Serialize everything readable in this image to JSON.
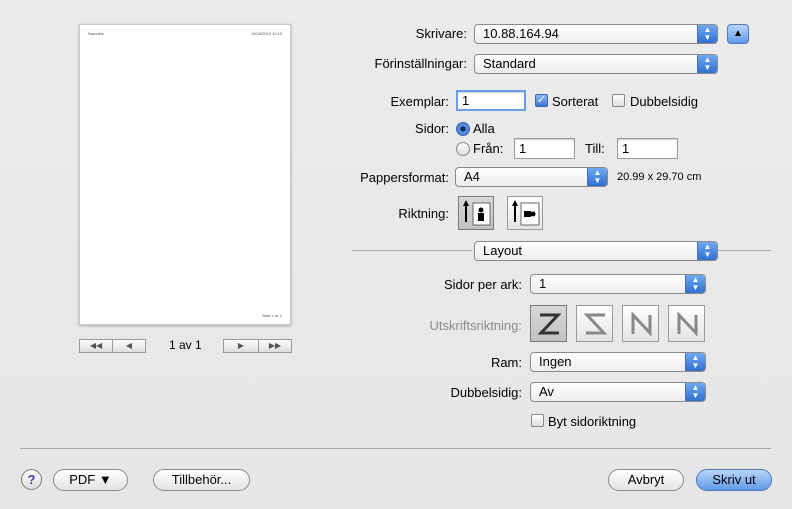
{
  "printer": {
    "label": "Skrivare:",
    "value": "10.88.164.94"
  },
  "presets": {
    "label": "Förinställningar:",
    "value": "Standard"
  },
  "copies": {
    "label": "Exemplar:",
    "value": "1",
    "collated_label": "Sorterat",
    "collated": true,
    "duplex_label": "Dubbelsidig",
    "duplex": false
  },
  "pages": {
    "label": "Sidor:",
    "all_label": "Alla",
    "from_label": "Från:",
    "from_value": "1",
    "to_label": "Till:",
    "to_value": "1"
  },
  "paper": {
    "label": "Pappersformat:",
    "value": "A4",
    "size_text": "20.99 x 29.70 cm"
  },
  "orientation": {
    "label": "Riktning:"
  },
  "section": {
    "value": "Layout"
  },
  "layout": {
    "pages_per_sheet_label": "Sidor per ark:",
    "pages_per_sheet": "1",
    "direction_label": "Utskriftsriktning:",
    "border_label": "Ram:",
    "border": "Ingen",
    "two_sided_label": "Dubbelsidig:",
    "two_sided": "Av",
    "flip_label": "Byt sidoriktning",
    "flip": false
  },
  "preview": {
    "page_indicator": "1 av 1",
    "header_left": "Namnlös",
    "header_right": "10/28/2010 10:19",
    "footer": "Sida 1 av 1"
  },
  "buttons": {
    "help": "?",
    "pdf": "PDF ▼",
    "accessories": "Tillbehör...",
    "cancel": "Avbryt",
    "print": "Skriv ut"
  },
  "colors": {
    "accent": "#3a78d6",
    "default_button": "#5e9be6"
  }
}
